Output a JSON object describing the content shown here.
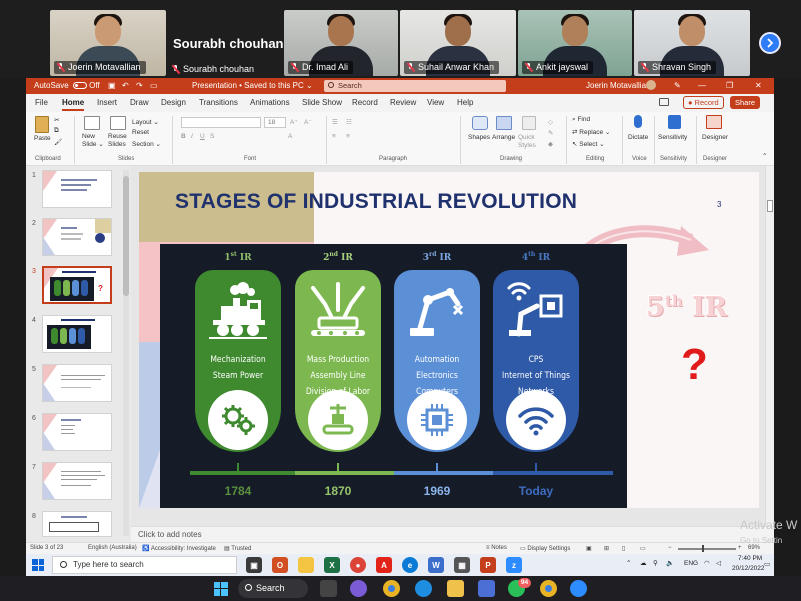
{
  "meeting": {
    "participants": [
      {
        "name": "Joerin Motavallian"
      },
      {
        "name": "Sourabh chouhan",
        "big_label": "Sourabh chouhan"
      },
      {
        "name": "Dr. Imad Ali"
      },
      {
        "name": "Suhail Anwar Khan"
      },
      {
        "name": "Ankit jayswal"
      },
      {
        "name": "Shravan Singh"
      }
    ]
  },
  "ppt": {
    "autosave_label": "AutoSave",
    "autosave_state": "Off",
    "doc_title": "Presentation • Saved to this PC ⌄",
    "search_placeholder": "Search",
    "user_name": "Joerin Motavallian",
    "menu_tabs": [
      "File",
      "Home",
      "Insert",
      "Draw",
      "Design",
      "Transitions",
      "Animations",
      "Slide Show",
      "Record",
      "Review",
      "View",
      "Help"
    ],
    "record_label": "Record",
    "share_label": "Share",
    "ribbon": {
      "paste": "Paste",
      "new_slide": "New Slide ⌄",
      "reuse_slides": "Reuse Slides",
      "layout": "Layout ⌄",
      "reset": "Reset",
      "section": "Section ⌄",
      "font_size": "18",
      "shapes": "Shapes",
      "arrange": "Arrange",
      "quick_styles": "Quick Styles",
      "find": "Find",
      "replace": "Replace ⌄",
      "select": "Select ⌄",
      "dictate": "Dictate",
      "sensitivity": "Sensitivity",
      "designer": "Designer",
      "groups": [
        "Clipboard",
        "Slides",
        "Font",
        "Paragraph",
        "Drawing",
        "Editing",
        "Voice",
        "Sensitivity",
        "Designer"
      ]
    },
    "thumbnails": [
      "1",
      "2",
      "3",
      "4",
      "5",
      "6",
      "7",
      "8"
    ],
    "notes_placeholder": "Click to add notes",
    "status": {
      "slide_of": "Slide 3 of 23",
      "language": "English (Australia)",
      "accessibility": "Accessibility: Investigate",
      "trusted": "Trusted",
      "notes": "Notes",
      "display_settings": "Display Settings",
      "zoom": "69%"
    }
  },
  "slide": {
    "title": "STAGES OF INDUSTRIAL REVOLUTION",
    "number": "3",
    "stages": [
      {
        "ord": "1",
        "suffix": "st",
        "abbr": "IR",
        "lines": [
          "Mechanization",
          "Steam Power"
        ],
        "year": "1784",
        "color": "#3f8a2e",
        "label_color": "#8fbf6a",
        "year_color": "#5a8f3c",
        "icon": "gears-icon",
        "image": "steam-train-icon"
      },
      {
        "ord": "2",
        "suffix": "nd",
        "abbr": "IR",
        "lines": [
          "Mass Production",
          "Assembly Line",
          "Division of Labor"
        ],
        "year": "1870",
        "color": "#7cb84f",
        "label_color": "#a8d07e",
        "year_color": "#96c46a",
        "icon": "conveyor-icon",
        "image": "robot-arms-icon"
      },
      {
        "ord": "3",
        "suffix": "rd",
        "abbr": "IR",
        "lines": [
          "Automation",
          "Electronics",
          "Computers"
        ],
        "year": "1969",
        "color": "#5b8fd6",
        "label_color": "#7da6e0",
        "year_color": "#8cb3ea",
        "icon": "chip-icon",
        "image": "industrial-robot-icon"
      },
      {
        "ord": "4",
        "suffix": "th",
        "abbr": "IR",
        "lines": [
          "CPS",
          "Internet of Things",
          "Networks"
        ],
        "year": "Today",
        "color": "#2f5aa8",
        "label_color": "#4a78c6",
        "year_color": "#3e6cc0",
        "icon": "wifi-icon",
        "image": "iot-robot-icon"
      }
    ],
    "fifth": {
      "ord": "5",
      "suffix": "th",
      "abbr": "IR"
    },
    "question": "?"
  },
  "watermark": {
    "line1": "Activate W",
    "line2": "Go to Settin"
  },
  "remote_taskbar": {
    "search_placeholder": "Type here to search",
    "language": "ENG",
    "time": "7:40 PM",
    "date": "20/12/2022"
  },
  "host_taskbar": {
    "search_label": "Search",
    "badge_count": "94"
  }
}
